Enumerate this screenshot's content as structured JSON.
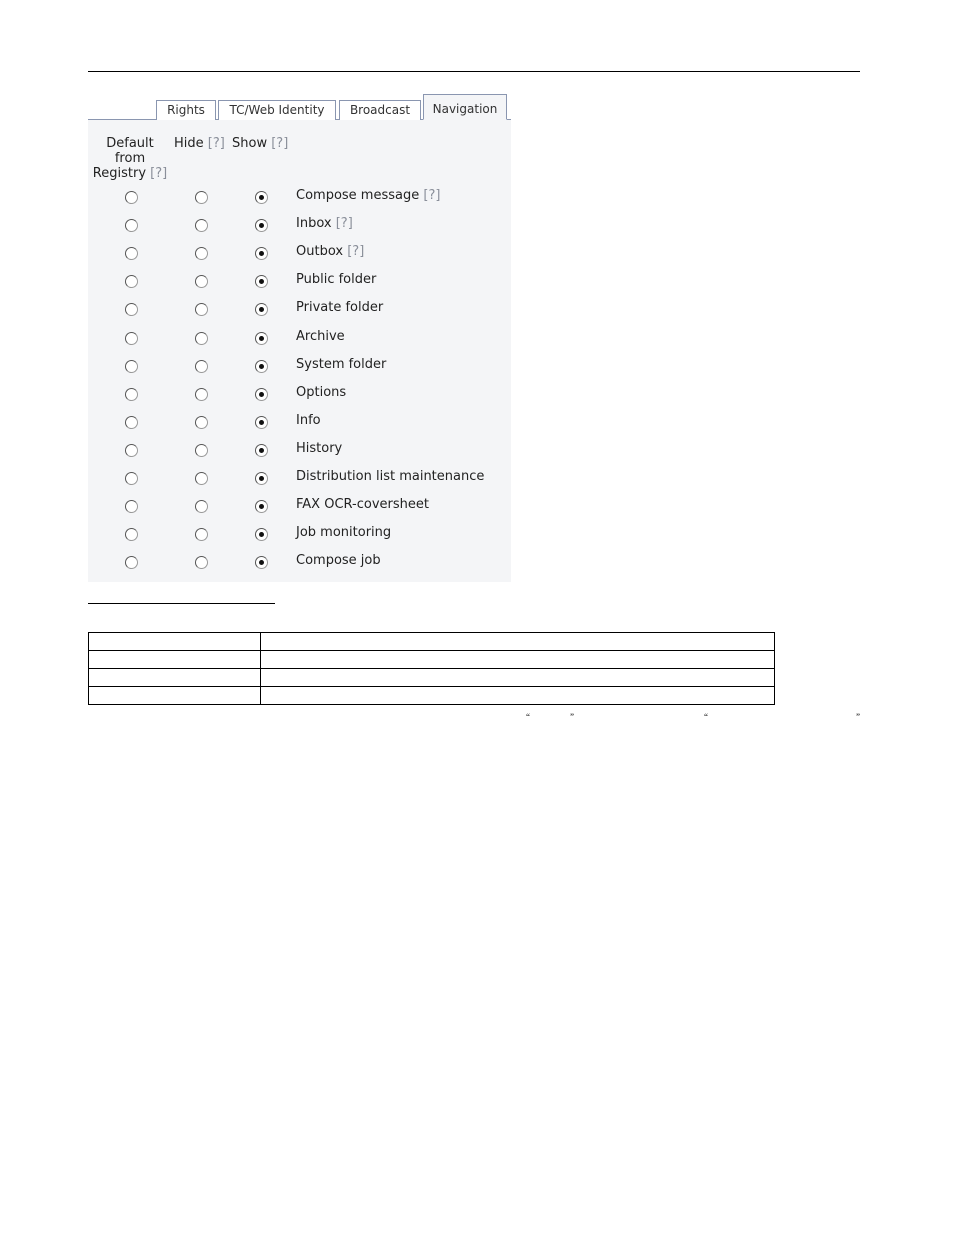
{
  "tabs": [
    {
      "label": "Rights"
    },
    {
      "label": "TC/Web Identity"
    },
    {
      "label": "Broadcast"
    },
    {
      "label": "Navigation",
      "active": true
    }
  ],
  "columns": {
    "default_line1": "Default",
    "default_line2": "from",
    "default_line3": "Registry",
    "hide": "Hide",
    "show": "Show",
    "help": "[?]"
  },
  "items": [
    {
      "label": "Compose message",
      "help": "[?]",
      "selected": "show"
    },
    {
      "label": "Inbox",
      "help": "[?]",
      "selected": "show"
    },
    {
      "label": "Outbox",
      "help": "[?]",
      "selected": "show"
    },
    {
      "label": "Public folder",
      "selected": "show"
    },
    {
      "label": "Private folder",
      "selected": "show"
    },
    {
      "label": "Archive",
      "selected": "show"
    },
    {
      "label": "System folder",
      "selected": "show"
    },
    {
      "label": "Options",
      "selected": "show"
    },
    {
      "label": "Info",
      "selected": "show"
    },
    {
      "label": "History",
      "selected": "show"
    },
    {
      "label": "Distribution list maintenance",
      "selected": "show"
    },
    {
      "label": "FAX OCR-coversheet",
      "selected": "show"
    },
    {
      "label": "Job monitoring",
      "selected": "show"
    },
    {
      "label": "Compose job",
      "selected": "show"
    }
  ],
  "table": {
    "rows": 4,
    "cols": 2
  },
  "quotes": {
    "open": "“",
    "close": "”"
  }
}
